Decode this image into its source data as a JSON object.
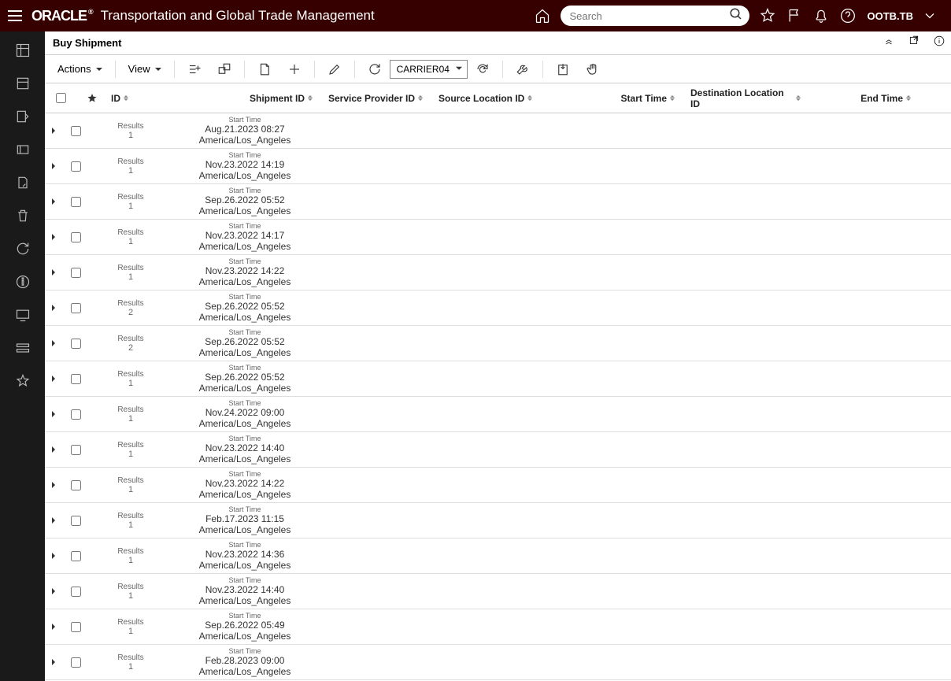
{
  "header": {
    "logo": "ORACLE",
    "title": "Transportation and Global Trade Management",
    "search_placeholder": "Search",
    "user": "OOTB.TB"
  },
  "page": {
    "title": "Buy Shipment"
  },
  "toolbar": {
    "actions": "Actions",
    "view": "View",
    "select_value": "CARRIER04"
  },
  "columns": {
    "id": "ID",
    "shipment": "Shipment ID",
    "sp": "Service Provider ID",
    "src": "Source Location ID",
    "start": "Start Time",
    "dest": "Destination Location ID",
    "end": "End Time"
  },
  "row_labels": {
    "results": "Results",
    "start_time": "Start Time"
  },
  "rows": [
    {
      "count": "1",
      "dt": "Aug.21.2023 08:27",
      "tz": "America/Los_Angeles"
    },
    {
      "count": "1",
      "dt": "Nov.23.2022 14:19",
      "tz": "America/Los_Angeles"
    },
    {
      "count": "1",
      "dt": "Sep.26.2022 05:52",
      "tz": "America/Los_Angeles"
    },
    {
      "count": "1",
      "dt": "Nov.23.2022 14:17",
      "tz": "America/Los_Angeles"
    },
    {
      "count": "1",
      "dt": "Nov.23.2022 14:22",
      "tz": "America/Los_Angeles"
    },
    {
      "count": "2",
      "dt": "Sep.26.2022 05:52",
      "tz": "America/Los_Angeles"
    },
    {
      "count": "2",
      "dt": "Sep.26.2022 05:52",
      "tz": "America/Los_Angeles"
    },
    {
      "count": "1",
      "dt": "Sep.26.2022 05:52",
      "tz": "America/Los_Angeles"
    },
    {
      "count": "1",
      "dt": "Nov.24.2022 09:00",
      "tz": "America/Los_Angeles"
    },
    {
      "count": "1",
      "dt": "Nov.23.2022 14:40",
      "tz": "America/Los_Angeles"
    },
    {
      "count": "1",
      "dt": "Nov.23.2022 14:22",
      "tz": "America/Los_Angeles"
    },
    {
      "count": "1",
      "dt": "Feb.17.2023 11:15",
      "tz": "America/Los_Angeles"
    },
    {
      "count": "1",
      "dt": "Nov.23.2022 14:36",
      "tz": "America/Los_Angeles"
    },
    {
      "count": "1",
      "dt": "Nov.23.2022 14:40",
      "tz": "America/Los_Angeles"
    },
    {
      "count": "1",
      "dt": "Sep.26.2022 05:49",
      "tz": "America/Los_Angeles"
    },
    {
      "count": "1",
      "dt": "Feb.28.2023 09:00",
      "tz": "America/Los_Angeles"
    }
  ]
}
